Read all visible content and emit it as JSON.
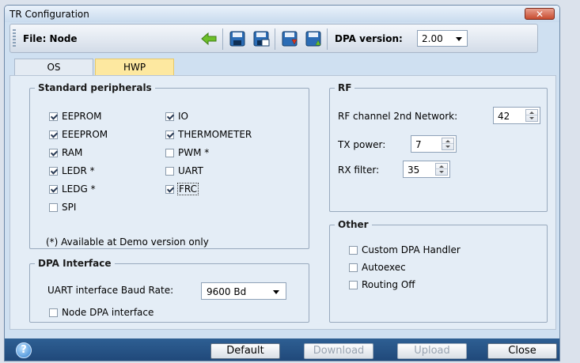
{
  "window": {
    "title": "TR Configuration",
    "close_label": "✕"
  },
  "toolbar": {
    "file_label": "File: Node",
    "dpa_version_label": "DPA version:",
    "dpa_version_value": "2.00"
  },
  "tabs": [
    {
      "label": "OS"
    },
    {
      "label": "HWP"
    }
  ],
  "standard_peripherals": {
    "legend": "Standard peripherals",
    "items": [
      {
        "label": "EEPROM",
        "checked": true
      },
      {
        "label": "EEEPROM",
        "checked": true
      },
      {
        "label": "RAM",
        "checked": true
      },
      {
        "label": "LEDR *",
        "checked": true
      },
      {
        "label": "LEDG *",
        "checked": true
      },
      {
        "label": "SPI",
        "checked": false
      },
      {
        "label": "IO",
        "checked": true
      },
      {
        "label": "THERMOMETER",
        "checked": true
      },
      {
        "label": "PWM *",
        "checked": false
      },
      {
        "label": "UART",
        "checked": false
      },
      {
        "label": "FRC",
        "checked": true
      }
    ],
    "note": "(*) Available at Demo version only"
  },
  "dpa_interface": {
    "legend": "DPA Interface",
    "baud_label": "UART interface Baud Rate:",
    "baud_value": "9600 Bd",
    "node_dpa_label": "Node DPA interface",
    "node_dpa_checked": false
  },
  "rf": {
    "legend": "RF",
    "channel_label": "RF channel 2nd Network:",
    "channel_value": "42",
    "tx_label": "TX power:",
    "tx_value": "7",
    "rx_label": "RX filter:",
    "rx_value": "35"
  },
  "other": {
    "legend": "Other",
    "items": [
      {
        "label": "Custom DPA Handler",
        "checked": false
      },
      {
        "label": "Autoexec",
        "checked": false
      },
      {
        "label": "Routing Off",
        "checked": false
      }
    ]
  },
  "buttons": {
    "default": "Default",
    "download": "Download",
    "upload": "Upload",
    "close": "Close"
  },
  "colors": {
    "accent_tab": "#fde8a0",
    "bottom_bar": "#1f4778",
    "icon_green": "#6cbf2a",
    "icon_blue": "#2b6cb5"
  },
  "icons": [
    "help-icon",
    "back-arrow-icon",
    "save-icon",
    "save-as-icon",
    "download-to-device-icon",
    "upload-from-device-icon",
    "chevron-down-icon"
  ]
}
